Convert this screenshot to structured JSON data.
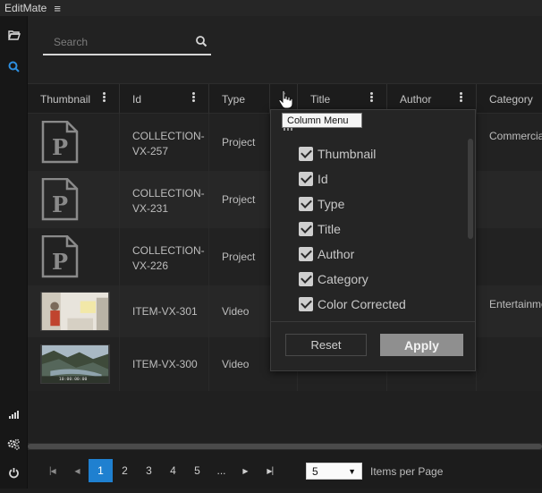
{
  "app": {
    "title": "EditMate"
  },
  "search": {
    "placeholder": "Search"
  },
  "columns": [
    {
      "label": "Thumbnail"
    },
    {
      "label": "Id"
    },
    {
      "label": "Type"
    },
    {
      "label": ""
    },
    {
      "label": "Title"
    },
    {
      "label": "Author"
    },
    {
      "label": "Category"
    }
  ],
  "rows": [
    {
      "thumb": "document-p",
      "id": "COLLECTION-VX-257",
      "type": "Project",
      "category": "Commercial"
    },
    {
      "thumb": "document-p",
      "id": "COLLECTION-VX-231",
      "type": "Project",
      "category": ""
    },
    {
      "thumb": "document-p",
      "id": "COLLECTION-VX-226",
      "type": "Project",
      "category": ""
    },
    {
      "thumb": "video-frame-office",
      "id": "ITEM-VX-301",
      "type": "Video",
      "category": "Entertainment"
    },
    {
      "thumb": "video-frame-fjord",
      "id": "ITEM-VX-300",
      "type": "Video",
      "category": "",
      "timecode": "10:00:00:00"
    }
  ],
  "column_menu": {
    "tooltip": "Column Menu",
    "items": [
      {
        "label": "Thumbnail",
        "checked": true
      },
      {
        "label": "Id",
        "checked": true
      },
      {
        "label": "Type",
        "checked": true
      },
      {
        "label": "Title",
        "checked": true
      },
      {
        "label": "Author",
        "checked": true
      },
      {
        "label": "Category",
        "checked": true
      },
      {
        "label": "Color Corrected",
        "checked": true
      }
    ],
    "reset_label": "Reset",
    "apply_label": "Apply"
  },
  "pagination": {
    "pages": [
      "1",
      "2",
      "3",
      "4",
      "5",
      "..."
    ],
    "active": "1",
    "page_size": "5",
    "page_size_label": "Items per Page"
  },
  "colors": {
    "accent": "#1f80d0",
    "background": "#1e1e1e"
  }
}
